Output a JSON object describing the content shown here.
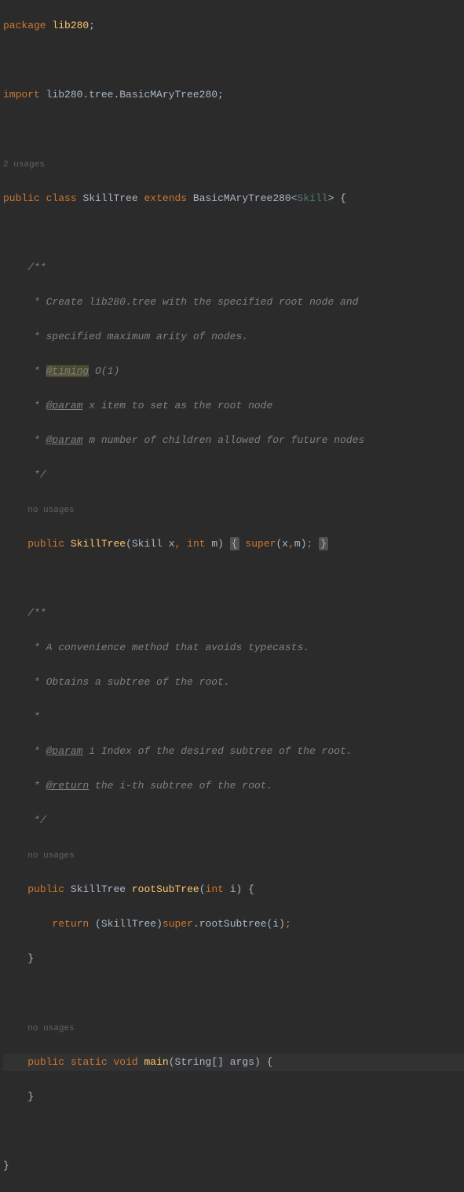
{
  "lines": {
    "l1_package": "package",
    "l1_pkg": "lib280",
    "l1_semi": ";",
    "l3_import": "import",
    "l3_path": "lib280.tree.BasicMAryTree280",
    "l3_semi": ";",
    "l5_usages": "2 usages",
    "l6_public": "public",
    "l6_class": "class",
    "l6_name": "SkillTree",
    "l6_extends": "extends",
    "l6_super": "BasicMAryTree280",
    "l6_lt": "<",
    "l6_generic": "Skill",
    "l6_gt": ">",
    "l6_brace": " {",
    "c1_1": "/**",
    "c1_2": " * Create lib280.tree with the specified root node and",
    "c1_3": " * specified maximum arity of nodes.",
    "c1_4_star": " * ",
    "c1_4_tag": "@timing",
    "c1_4_rest": " O(1)",
    "c1_5_star": " * ",
    "c1_5_tag": "@param",
    "c1_5_rest": " x item to set as the root node",
    "c1_6_star": " * ",
    "c1_6_tag": "@param",
    "c1_6_rest": " m number of children allowed for future nodes",
    "c1_7": " */",
    "nu1": "no usages",
    "m1_public": "public",
    "m1_name": "SkillTree",
    "m1_p1type": "Skill",
    "m1_p1": "x",
    "m1_p2type": "int",
    "m1_p2": "m",
    "m1_super": "super",
    "m1_a1": "x",
    "m1_a2": "m",
    "c2_1": "/**",
    "c2_2": " * A convenience method that avoids typecasts.",
    "c2_3": " * Obtains a subtree of the root.",
    "c2_4": " *",
    "c2_5_star": " * ",
    "c2_5_tag": "@param",
    "c2_5_rest": " i Index of the desired subtree of the root.",
    "c2_6_star": " * ",
    "c2_6_tag": "@return",
    "c2_6_rest": " the i-th subtree of the root.",
    "c2_7": " */",
    "nu2": "no usages",
    "m2_public": "public",
    "m2_ret": "SkillTree",
    "m2_name": "rootSubTree",
    "m2_ptype": "int",
    "m2_p": "i",
    "m2_return": "return",
    "m2_cast": "SkillTree",
    "m2_super": "super",
    "m2_call": "rootSubtree",
    "m2_arg": "i",
    "nu3": "no usages",
    "m3_public": "public",
    "m3_static": "static",
    "m3_void": "void",
    "m3_name": "main",
    "m3_ptype": "String",
    "m3_brackets": "[]",
    "m3_p": "args"
  }
}
